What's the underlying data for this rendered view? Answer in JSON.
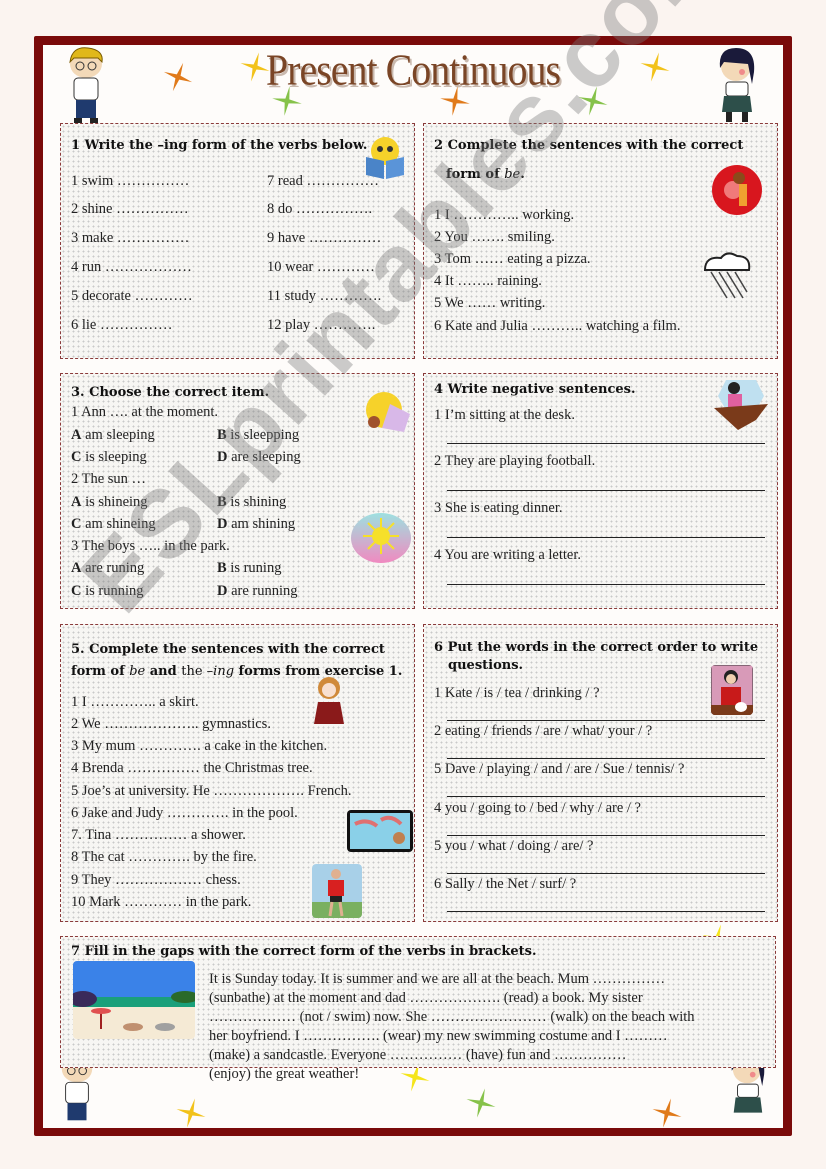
{
  "title": "Present Continuous",
  "ex1": {
    "heading": "1 Write the –ing form of the verbs below.",
    "left": [
      "1 swim ……………",
      "2 shine ……………",
      "3 make ……………",
      "4 run ………………",
      "5 decorate …………",
      "6 lie ……………"
    ],
    "right": [
      "7 read ……………",
      "8 do …………….",
      "9 have ……………",
      "10 wear …………",
      "11 study ………….",
      "12 play …………."
    ]
  },
  "ex2": {
    "heading_line1": "2 Complete the sentences with the correct",
    "heading_line2": "form of ",
    "heading_italic": "be",
    "heading_end": ".",
    "items": [
      "1 I ………….. working.",
      "2 You ……. smiling.",
      "3 Tom …… eating a pizza.",
      "4 It …….. raining.",
      "5 We …… writing.",
      "6 Kate and Julia ……….. watching a film."
    ]
  },
  "ex3": {
    "heading": "3. Choose the correct item.",
    "questions": [
      {
        "stem": "1 Ann …. at the moment.",
        "options": [
          [
            "A",
            "am sleeping"
          ],
          [
            "B",
            "is sleepping"
          ],
          [
            "C",
            "is sleeping"
          ],
          [
            "D",
            "are sleeping"
          ]
        ]
      },
      {
        "stem": "2 The sun …",
        "options": [
          [
            "A",
            "is shineing"
          ],
          [
            "B",
            "is shining"
          ],
          [
            "C",
            "am shineing"
          ],
          [
            "D",
            "am shining"
          ]
        ]
      },
      {
        "stem": "3 The boys ….. in the park.",
        "options": [
          [
            "A",
            "are runing"
          ],
          [
            "B",
            "is runing"
          ],
          [
            "C",
            "is running"
          ],
          [
            "D",
            "are running"
          ]
        ]
      }
    ]
  },
  "ex4": {
    "heading": "4 Write negative sentences.",
    "items": [
      "1 I’m sitting at the desk.",
      "2 They are playing football.",
      "3 She is eating dinner.",
      "4 You are writing a letter."
    ]
  },
  "ex5": {
    "heading_line1": "5. Complete the sentences with the correct",
    "heading_line2_a": "form of ",
    "heading_line2_be": "be",
    "heading_line2_b": " and ",
    "heading_line2_the": "the ",
    "heading_line2_ing": "–ing",
    "heading_line2_c": " forms from exercise 1.",
    "items": [
      "1 I ………….. a skirt.",
      "2 We ……………….. gymnastics.",
      "3 My mum …………. a cake in the kitchen.",
      "4 Brenda …………… the Christmas tree.",
      "5 Joe’s at university. He ………………. French.",
      "6 Jake and Judy …………. in the pool.",
      "7. Tina …………… a shower.",
      "8 The cat …………. by the fire.",
      "9 They ……………… chess.",
      "10 Mark ………… in the park."
    ]
  },
  "ex6": {
    "heading_line1": "6 Put the words in the correct order to write",
    "heading_line2": "questions.",
    "items": [
      "1 Kate / is / tea / drinking / ?",
      "2 eating / friends / are / what/ your / ?",
      "5 Dave / playing / and / are / Sue / tennis/ ?",
      "4 you / going to / bed / why / are / ?",
      "5 you / what / doing / are/ ?",
      "6 Sally / the Net / surf/ ?"
    ]
  },
  "ex7": {
    "heading": "7 Fill in the gaps with the correct form of the verbs in brackets.",
    "lines": [
      "It is Sunday today. It is summer and we are all at the beach. Mum ……………",
      "(sunbathe) at the moment and dad ………………. (read) a book. My sister",
      "……………… (not / swim) now. She …………………… (walk) on the beach with",
      "her boyfriend. I ……………. (wear) my new swimming costume and I ………",
      "(make) a sandcastle. Everyone …………… (have) fun and ……………",
      "(enjoy) the great weather!"
    ]
  },
  "watermark": "ESLprintables.com",
  "colors": {
    "frame": "#7a0a0a",
    "title": "#7a4526",
    "star_orange": "#e07a1a",
    "star_yellow": "#f2c21a",
    "star_green": "#86c24a"
  }
}
